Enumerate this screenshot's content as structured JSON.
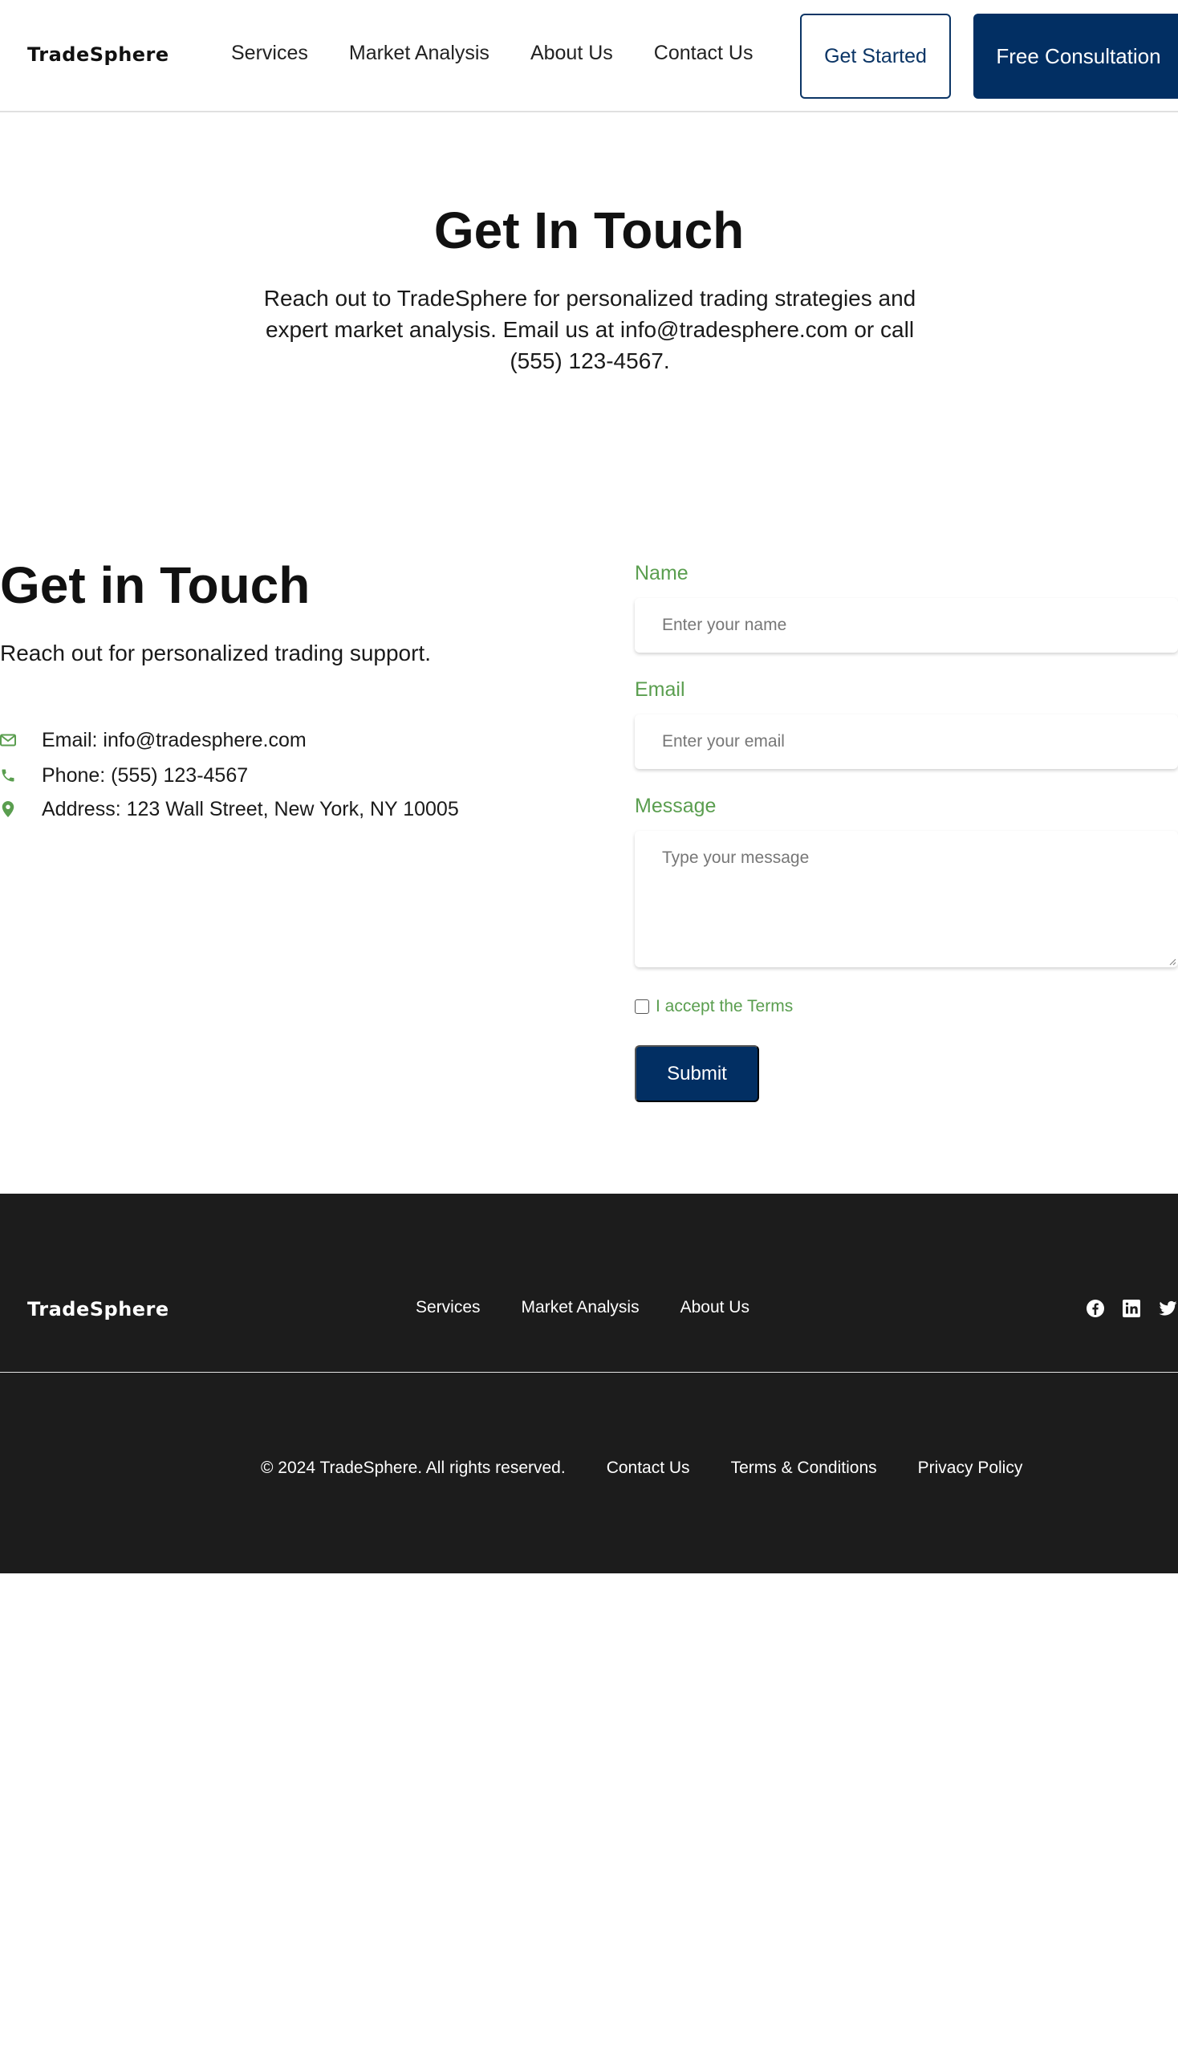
{
  "nav": {
    "logo": "TradeSphere",
    "links": [
      "Services",
      "Market Analysis",
      "About Us",
      "Contact Us"
    ],
    "get_started": "Get Started",
    "free_consultation": "Free Consultation"
  },
  "hero": {
    "title": "Get In Touch",
    "text": "Reach out to TradeSphere for personalized trading strategies and expert market analysis. Email us at info@tradesphere.com or call (555) 123-4567."
  },
  "contact": {
    "title": "Get in Touch",
    "subtitle": "Reach out for personalized trading support.",
    "email": "Email: info@tradesphere.com",
    "phone": "Phone: (555) 123-4567",
    "address": "Address: 123 Wall Street, New York, NY 10005"
  },
  "form": {
    "name_label": "Name",
    "name_placeholder": "Enter your name",
    "email_label": "Email",
    "email_placeholder": "Enter your email",
    "message_label": "Message",
    "message_placeholder": "Type your message",
    "terms_label": "I accept the Terms",
    "submit_label": "Submit"
  },
  "footer": {
    "logo": "TradeSphere",
    "links": [
      "Services",
      "Market Analysis",
      "About Us"
    ],
    "copyright": "© 2024 TradeSphere. All rights reserved.",
    "bottom_links": [
      "Contact Us",
      "Terms & Conditions",
      "Privacy Policy"
    ],
    "social_icons": [
      "facebook-icon",
      "linkedin-icon",
      "twitter-icon"
    ]
  },
  "colors": {
    "brand_navy": "#022f63",
    "accent_green": "#5a9e4f",
    "footer_bg": "#1c1c1c"
  }
}
